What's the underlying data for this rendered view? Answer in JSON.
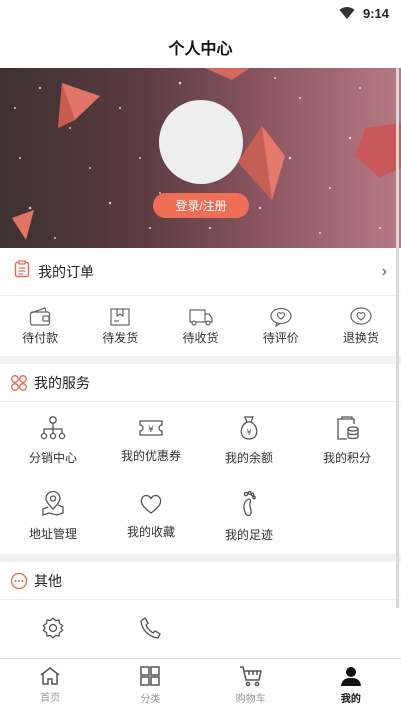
{
  "status": {
    "time": "9:14"
  },
  "header": {
    "title": "个人中心"
  },
  "profile": {
    "login_label": "登录/注册"
  },
  "orders": {
    "title": "我的订单",
    "items": [
      {
        "label": "待付款",
        "icon": "wallet-icon"
      },
      {
        "label": "待发货",
        "icon": "package-icon"
      },
      {
        "label": "待收货",
        "icon": "truck-icon"
      },
      {
        "label": "待评价",
        "icon": "comment-heart-icon"
      },
      {
        "label": "退换货",
        "icon": "return-heart-icon"
      }
    ]
  },
  "services": {
    "title": "我的服务",
    "items": [
      {
        "label": "分销中心",
        "icon": "network-icon"
      },
      {
        "label": "我的优惠券",
        "icon": "coupon-icon"
      },
      {
        "label": "我的余额",
        "icon": "money-bag-icon"
      },
      {
        "label": "我的积分",
        "icon": "points-icon"
      },
      {
        "label": "地址管理",
        "icon": "location-icon"
      },
      {
        "label": "我的收藏",
        "icon": "heart-icon"
      },
      {
        "label": "我的足迹",
        "icon": "footprint-icon"
      }
    ]
  },
  "other": {
    "title": "其他",
    "items": [
      {
        "icon": "settings-icon"
      },
      {
        "icon": "phone-icon"
      }
    ]
  },
  "tabbar": {
    "items": [
      {
        "label": "首页",
        "icon": "home-icon",
        "active": false
      },
      {
        "label": "分类",
        "icon": "category-icon",
        "active": false
      },
      {
        "label": "购物车",
        "icon": "cart-icon",
        "active": false
      },
      {
        "label": "我的",
        "icon": "user-icon",
        "active": true
      }
    ]
  },
  "colors": {
    "accent": "#ef6f56",
    "section_icon": "#e8674f"
  }
}
